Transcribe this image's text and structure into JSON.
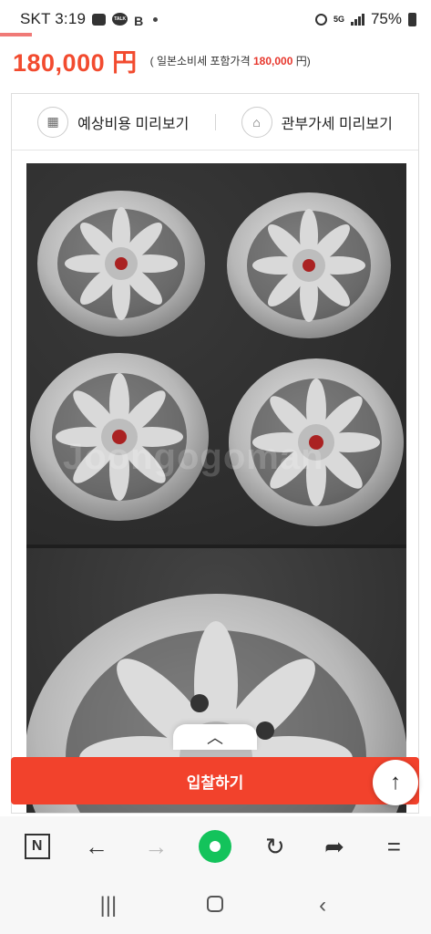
{
  "status_bar": {
    "carrier_time": "SKT 3:19",
    "battery": "75%",
    "network": "5G"
  },
  "price": {
    "amount": "180,000 円",
    "note_prefix": "( 일본소비세 포함가격",
    "note_value": "180,000",
    "note_suffix": "円)"
  },
  "preview": {
    "shipping_cost_label": "예상비용 미리보기",
    "customs_label": "관부가세 미리보기"
  },
  "photo": {
    "watermark": "Joongogoman"
  },
  "actions": {
    "bid_label": "입찰하기"
  },
  "colors": {
    "accent": "#f2422c",
    "price": "#f24b2f",
    "naver_green": "#13c35b"
  }
}
